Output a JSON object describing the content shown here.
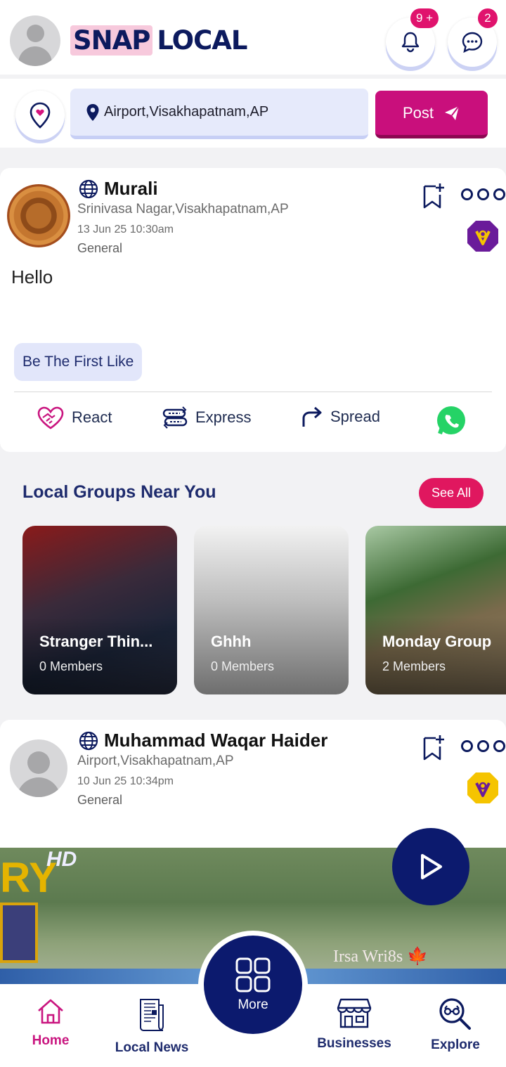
{
  "header": {
    "logo_part1": "SNAP",
    "logo_part2": "LOCAL",
    "notifications_badge": "9 +",
    "messages_badge": "2"
  },
  "location_bar": {
    "location_value": "Airport,Visakhapatnam,AP",
    "post_label": "Post"
  },
  "posts": [
    {
      "author": "Murali",
      "location": "Srinivasa Nagar,Visakhapatnam,AP",
      "timestamp": "13 Jun 25 10:30am",
      "category": "General",
      "text": "Hello",
      "like_prompt": "Be The First Like",
      "badge_color": "#6a1b9a"
    },
    {
      "author": "Muhammad Waqar Haider",
      "location": "Airport,Visakhapatnam,AP",
      "timestamp": "10 Jun 25 10:34pm",
      "category": "General",
      "badge_color": "#f5c400"
    }
  ],
  "actions": {
    "react": "React",
    "express": "Express",
    "spread": "Spread"
  },
  "groups": {
    "title": "Local Groups Near You",
    "see_all": "See All",
    "items": [
      {
        "name": "Stranger Thin...",
        "members": "0 Members"
      },
      {
        "name": "Ghhh",
        "members": "0 Members"
      },
      {
        "name": "Monday Group",
        "members": "2 Members"
      }
    ]
  },
  "video": {
    "overlay_text_hd": "HD",
    "overlay_text_ry": "RY",
    "watermark": "Irsa Wri8s 🍁"
  },
  "bottom_nav": {
    "home": "Home",
    "local_news": "Local News",
    "more": "More",
    "businesses": "Businesses",
    "explore": "Explore"
  },
  "colors": {
    "brand_navy": "#0c1a6e",
    "brand_pink": "#c90f7c",
    "see_all_red": "#e0175f"
  }
}
